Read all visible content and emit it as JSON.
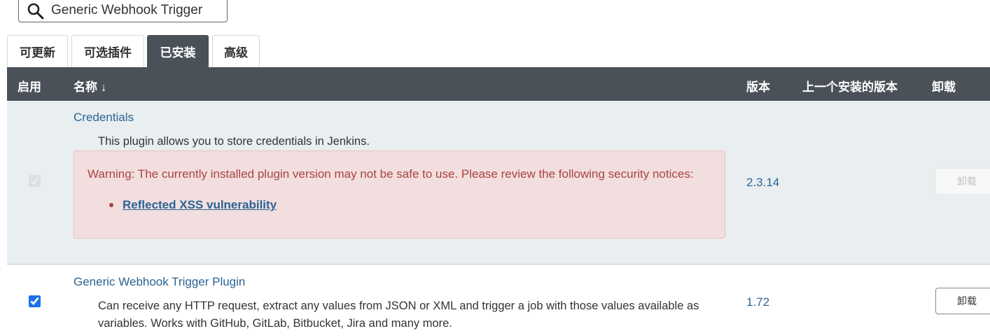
{
  "search": {
    "value": "Generic Webhook Trigger",
    "icon": "search-icon"
  },
  "tabs": [
    {
      "label": "可更新"
    },
    {
      "label": "可选插件"
    },
    {
      "label": "已安装"
    },
    {
      "label": "高级"
    }
  ],
  "active_tab": "已安装",
  "table": {
    "headers": {
      "enabled": "启用",
      "name": "名称 ↓",
      "version": "版本",
      "previous": "上一个安装的版本",
      "uninstall": "卸载"
    }
  },
  "plugins": [
    {
      "name": "Credentials",
      "description": "This plugin allows you to store credentials in Jenkins.",
      "enabled": true,
      "checkbox_disabled": true,
      "version": "2.3.14",
      "warning": "Warning: The currently installed plugin version may not be safe to use. Please review the following security notices:",
      "warning_link": "Reflected XSS vulnerability",
      "uninstall_label": "卸载",
      "uninstall_disabled": true
    },
    {
      "name": "Generic Webhook Trigger Plugin",
      "description_line1": "Can receive any HTTP request, extract any values from JSON or XML and trigger a job with those values available as",
      "description_line2": "variables. Works with GitHub, GitLab, Bitbucket, Jira and many more.",
      "enabled": true,
      "checkbox_disabled": false,
      "version": "1.72",
      "uninstall_label": "卸载",
      "uninstall_disabled": false
    }
  ],
  "colors": {
    "header_bg": "#4a5159",
    "row_highlight": "#e9eef1",
    "link": "#2a6496",
    "warning_bg": "#f2dede",
    "warning_text": "#a94442"
  }
}
